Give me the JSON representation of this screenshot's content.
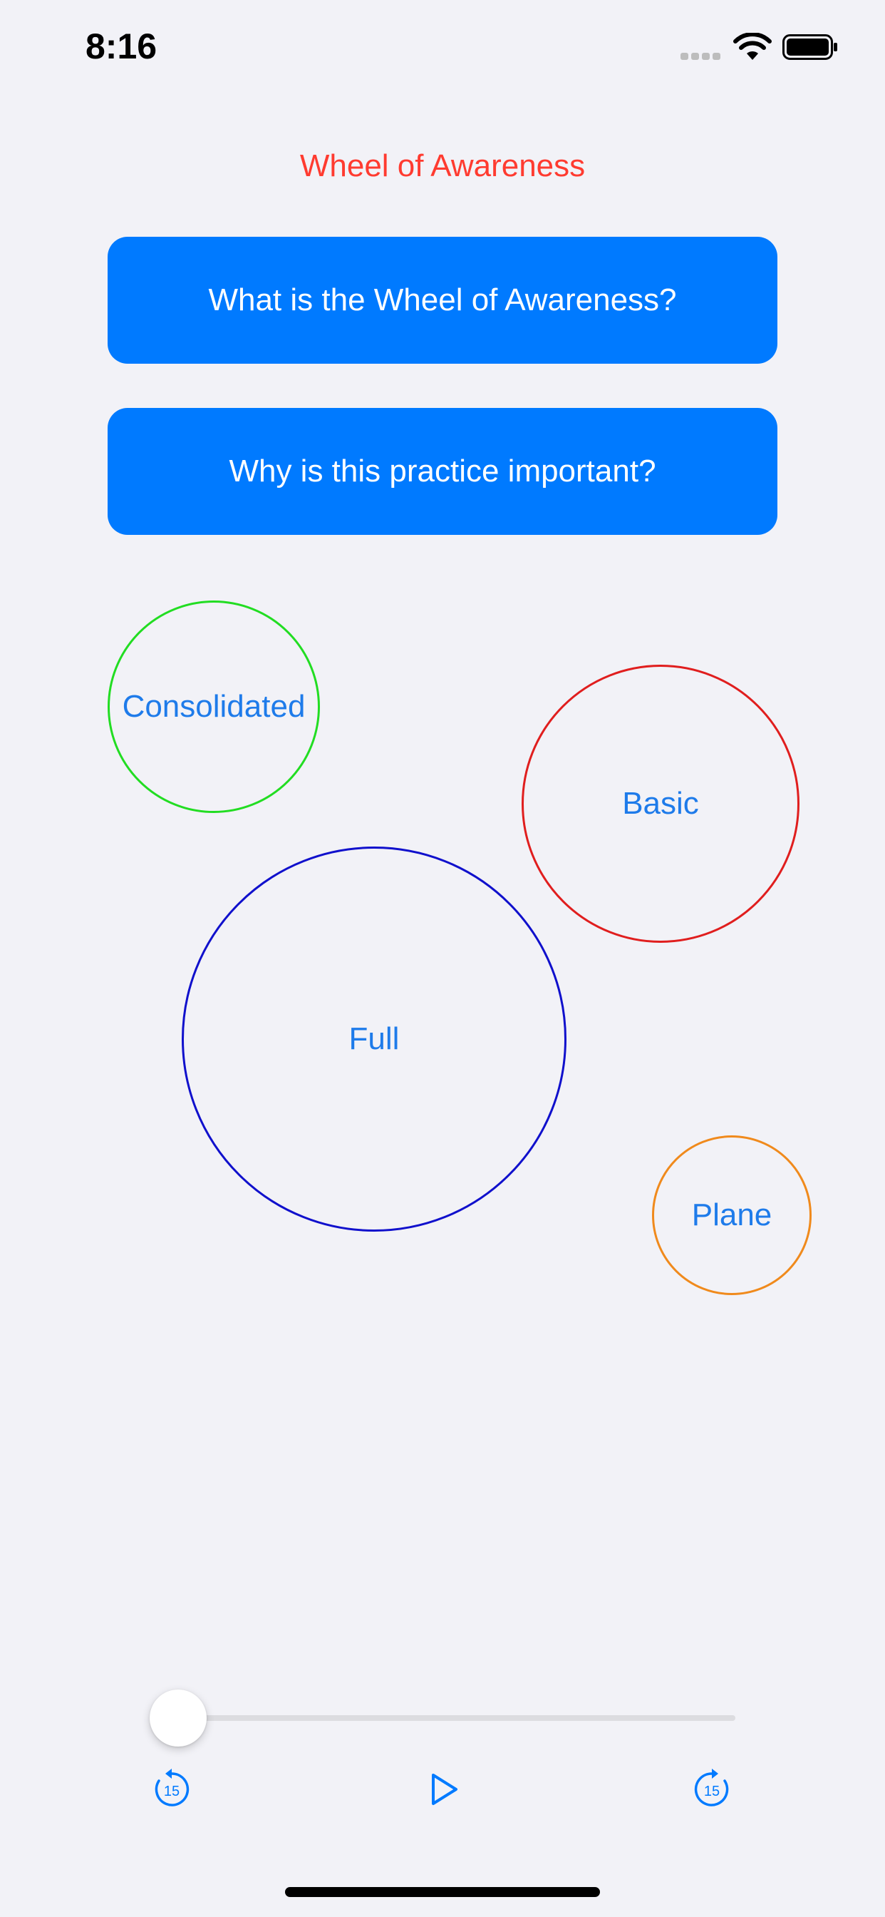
{
  "status_bar": {
    "time": "8:16"
  },
  "header": {
    "title": "Wheel of Awareness"
  },
  "buttons": {
    "what_is": "What is the Wheel of Awareness?",
    "why_important": "Why is this practice important?"
  },
  "practices": [
    {
      "label": "Consolidated",
      "color": "#22dd22"
    },
    {
      "label": "Basic",
      "color": "#e01e1e"
    },
    {
      "label": "Full",
      "color": "#1010cc"
    },
    {
      "label": "Plane",
      "color": "#f08a1c"
    }
  ],
  "player": {
    "progress": 0,
    "skip_back_label": "15",
    "skip_forward_label": "15",
    "accent_color": "#007aff"
  }
}
